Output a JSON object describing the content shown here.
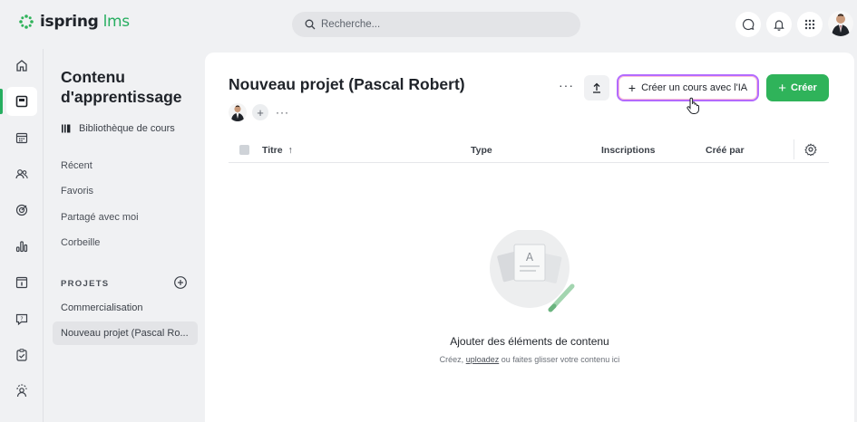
{
  "app": {
    "logo_prefix": "ispring",
    "logo_suffix": "lms"
  },
  "search": {
    "placeholder": "Recherche..."
  },
  "sidebar": {
    "title": "Contenu d'apprentissage",
    "library_label": "Bibliothèque de cours",
    "links": [
      "Récent",
      "Favoris",
      "Partagé avec moi",
      "Corbeille"
    ],
    "projects_section": "PROJETS",
    "projects": [
      "Commercialisation",
      "Nouveau projet (Pascal Ro..."
    ]
  },
  "rail": {
    "icons": [
      "home-icon",
      "content-icon",
      "calendar-icon",
      "users-icon",
      "goals-icon",
      "reports-icon",
      "info-icon",
      "help-icon",
      "tasks-icon",
      "support-icon"
    ]
  },
  "main": {
    "title": "Nouveau projet (Pascal Robert)",
    "more_label": "···",
    "ai_button_label": "Créer un cours avec l'IA",
    "create_button_label": "Créer",
    "columns": {
      "title": "Titre",
      "type": "Type",
      "enrollments": "Inscriptions",
      "created_by": "Créé par"
    },
    "empty": {
      "title": "Ajouter des éléments de contenu",
      "subtitle_prefix": "Créez, ",
      "subtitle_link": "uploadez",
      "subtitle_suffix": " ou faites glisser votre contenu ici"
    }
  },
  "colors": {
    "brand_green": "#2fb35a",
    "ai_border": "#b36bff",
    "background": "#f0f1f3"
  }
}
